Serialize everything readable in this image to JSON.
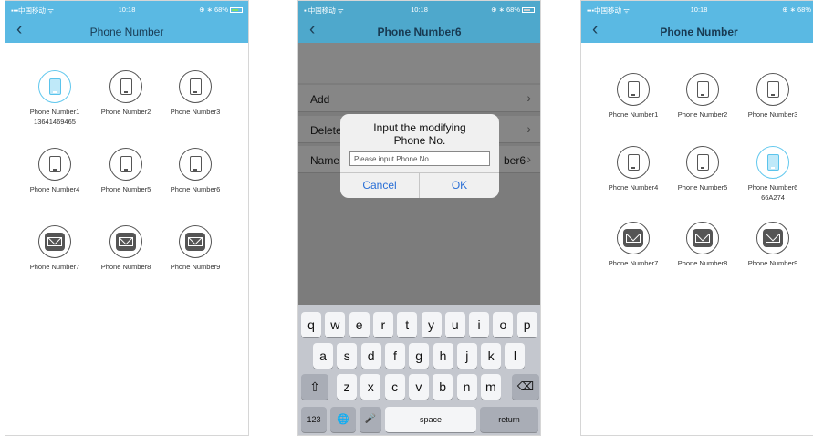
{
  "status": {
    "carrier": "中国移动",
    "time": "10:18",
    "battery": "68%",
    "accent": "#5ab9e3"
  },
  "screen1": {
    "title": "Phone Number",
    "items": [
      {
        "label": "Phone Number1",
        "sub": "13641469465"
      },
      {
        "label": "Phone Number2"
      },
      {
        "label": "Phone Number3"
      },
      {
        "label": "Phone Number4"
      },
      {
        "label": "Phone Number5"
      },
      {
        "label": "Phone Number6"
      },
      {
        "label": "Phone Number7"
      },
      {
        "label": "Phone Number8"
      },
      {
        "label": "Phone Number9"
      }
    ]
  },
  "screen2": {
    "title": "Phone Number6",
    "menu": [
      {
        "label": "Add"
      },
      {
        "label": "Delete"
      },
      {
        "label": "Name",
        "value": "ber6"
      }
    ],
    "dialog": {
      "title_line1": "Input the modifying",
      "title_line2": "Phone No.",
      "placeholder": "Please input Phone No.",
      "cancel": "Cancel",
      "ok": "OK"
    },
    "keyboard": {
      "row1": [
        "q",
        "w",
        "e",
        "r",
        "t",
        "y",
        "u",
        "i",
        "o",
        "p"
      ],
      "row2": [
        "a",
        "s",
        "d",
        "f",
        "g",
        "h",
        "j",
        "k",
        "l"
      ],
      "row3": [
        "z",
        "x",
        "c",
        "v",
        "b",
        "n",
        "m"
      ],
      "numbers": "123",
      "space": "space",
      "return": "return"
    }
  },
  "screen3": {
    "title": "Phone Number",
    "items": [
      {
        "label": "Phone Number1"
      },
      {
        "label": "Phone Number2"
      },
      {
        "label": "Phone Number3"
      },
      {
        "label": "Phone Number4"
      },
      {
        "label": "Phone Number5"
      },
      {
        "label": "Phone Number6",
        "sub": "66A274"
      },
      {
        "label": "Phone Number7"
      },
      {
        "label": "Phone Number8"
      },
      {
        "label": "Phone Number9"
      }
    ]
  }
}
